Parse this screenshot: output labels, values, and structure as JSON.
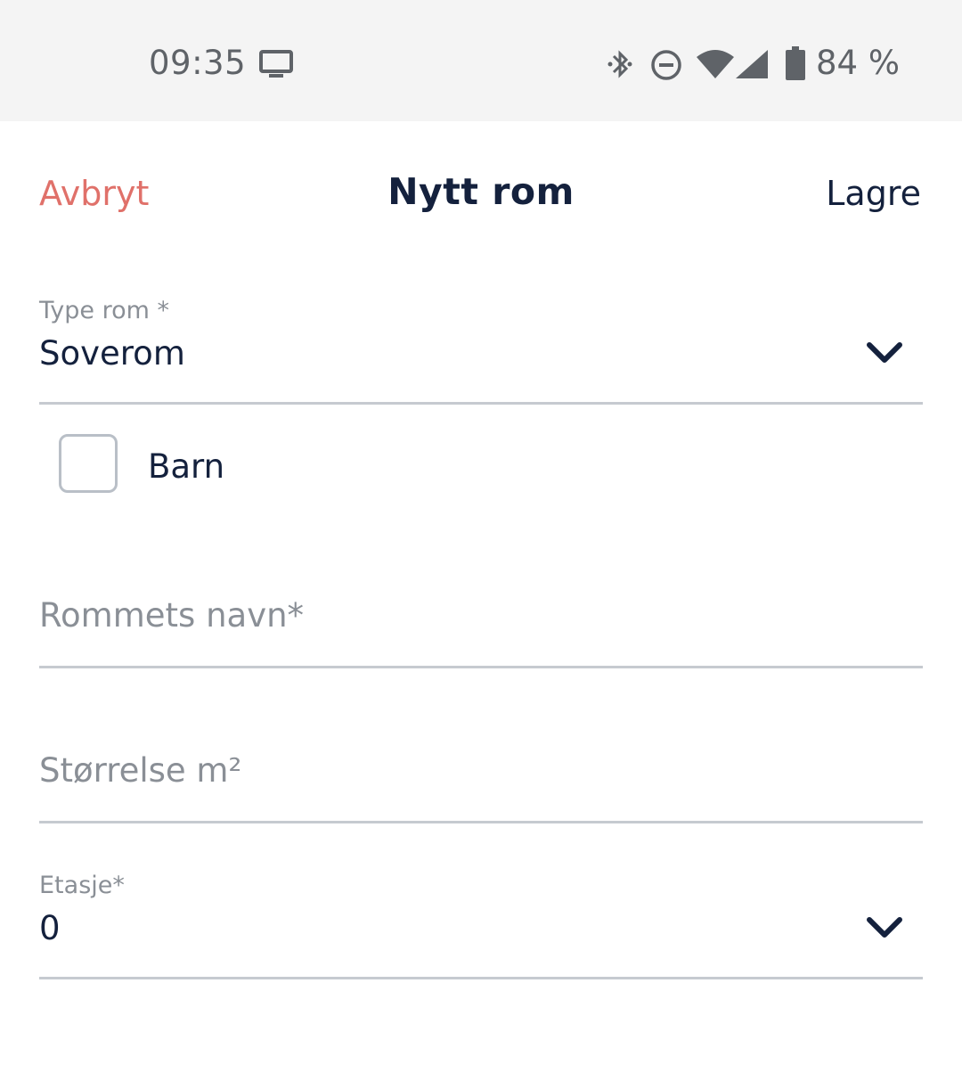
{
  "status_bar": {
    "time": "09:35",
    "icons": [
      "cast-icon",
      "bluetooth-icon",
      "do-not-disturb-icon",
      "wifi-icon",
      "cellular-signal-icon",
      "battery-icon"
    ],
    "battery_text": "84 %"
  },
  "header": {
    "cancel_label": "Avbryt",
    "title": "Nytt rom",
    "save_label": "Lagre"
  },
  "form": {
    "room_type": {
      "label": "Type rom *",
      "value": "Soverom"
    },
    "child_checkbox": {
      "label": "Barn",
      "checked": false
    },
    "room_name": {
      "placeholder": "Rommets navn*",
      "value": ""
    },
    "size": {
      "placeholder": "Størrelse m²",
      "value": ""
    },
    "floor": {
      "label": "Etasje*",
      "value": "0"
    }
  },
  "colors": {
    "accent_cancel": "#e0716a",
    "text_primary": "#14213d",
    "text_secondary": "#8a8f96",
    "divider": "#c6cad0",
    "status_bar_bg": "#f4f4f4"
  }
}
